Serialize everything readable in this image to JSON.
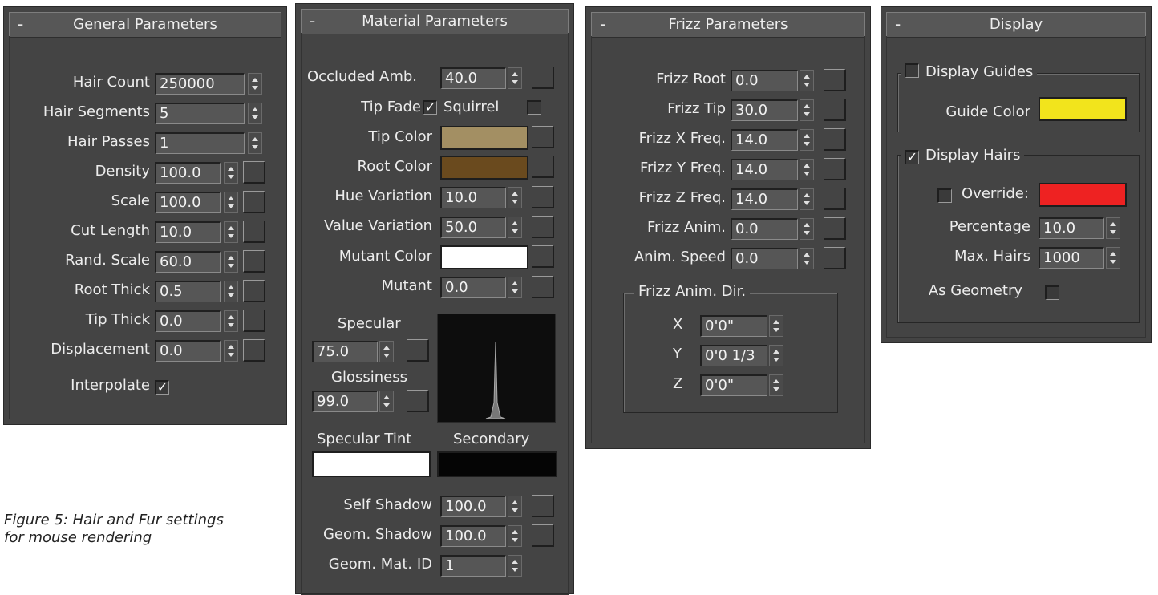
{
  "caption": {
    "line1": "Figure 5: Hair and Fur settings",
    "line2": "for mouse rendering"
  },
  "general": {
    "title": "General Parameters",
    "rows": [
      {
        "label": "Hair Count",
        "value": "250000"
      },
      {
        "label": "Hair Segments",
        "value": "5"
      },
      {
        "label": "Hair Passes",
        "value": "1"
      },
      {
        "label": "Density",
        "value": "100.0"
      },
      {
        "label": "Scale",
        "value": "100.0"
      },
      {
        "label": "Cut Length",
        "value": "10.0"
      },
      {
        "label": "Rand. Scale",
        "value": "60.0"
      },
      {
        "label": "Root Thick",
        "value": "0.5"
      },
      {
        "label": "Tip Thick",
        "value": "0.0"
      },
      {
        "label": "Displacement",
        "value": "0.0"
      }
    ],
    "interpolate_label": "Interpolate",
    "interpolate_checked": true
  },
  "material": {
    "title": "Material Parameters",
    "occluded_label": "Occluded Amb.",
    "occluded_value": "40.0",
    "tip_fade_label": "Tip Fade",
    "tip_fade_checked": true,
    "squirrel_label": "Squirrel",
    "squirrel_checked": false,
    "tip_color_label": "Tip Color",
    "tip_color": "#a38f63",
    "root_color_label": "Root Color",
    "root_color": "#6a4a1e",
    "hue_label": "Hue Variation",
    "hue_value": "10.0",
    "value_var_label": "Value Variation",
    "value_var_value": "50.0",
    "mutant_color_label": "Mutant Color",
    "mutant_color": "#ffffff",
    "mutant_label": "Mutant",
    "mutant_value": "0.0",
    "specular_label": "Specular",
    "specular_value": "75.0",
    "glossiness_label": "Glossiness",
    "glossiness_value": "99.0",
    "spec_tint_label": "Specular Tint",
    "spec_tint_color": "#ffffff",
    "secondary_label": "Secondary",
    "secondary_color": "#050505",
    "self_shadow_label": "Self Shadow",
    "self_shadow_value": "100.0",
    "geom_shadow_label": "Geom. Shadow",
    "geom_shadow_value": "100.0",
    "geom_mat_label": "Geom. Mat. ID",
    "geom_mat_value": "1"
  },
  "frizz": {
    "title": "Frizz Parameters",
    "rows": [
      {
        "label": "Frizz Root",
        "value": "0.0"
      },
      {
        "label": "Frizz Tip",
        "value": "30.0"
      },
      {
        "label": "Frizz X Freq.",
        "value": "14.0"
      },
      {
        "label": "Frizz Y Freq.",
        "value": "14.0"
      },
      {
        "label": "Frizz Z Freq.",
        "value": "14.0"
      },
      {
        "label": "Frizz Anim.",
        "value": "0.0"
      },
      {
        "label": "Anim. Speed",
        "value": "0.0"
      }
    ],
    "dir_group": "Frizz Anim. Dir.",
    "dir": [
      {
        "label": "X",
        "value": "0'0\""
      },
      {
        "label": "Y",
        "value": "0'0 1/3"
      },
      {
        "label": "Z",
        "value": "0'0\""
      }
    ]
  },
  "display": {
    "title": "Display",
    "display_guides_label": "Display Guides",
    "display_guides_checked": false,
    "guide_color_label": "Guide Color",
    "guide_color": "#f2e41c",
    "display_hairs_label": "Display Hairs",
    "display_hairs_checked": true,
    "override_label": "Override:",
    "override_checked": false,
    "override_color": "#ee2222",
    "percentage_label": "Percentage",
    "percentage_value": "10.0",
    "max_hairs_label": "Max. Hairs",
    "max_hairs_value": "1000",
    "as_geometry_label": "As Geometry",
    "as_geometry_checked": false
  }
}
